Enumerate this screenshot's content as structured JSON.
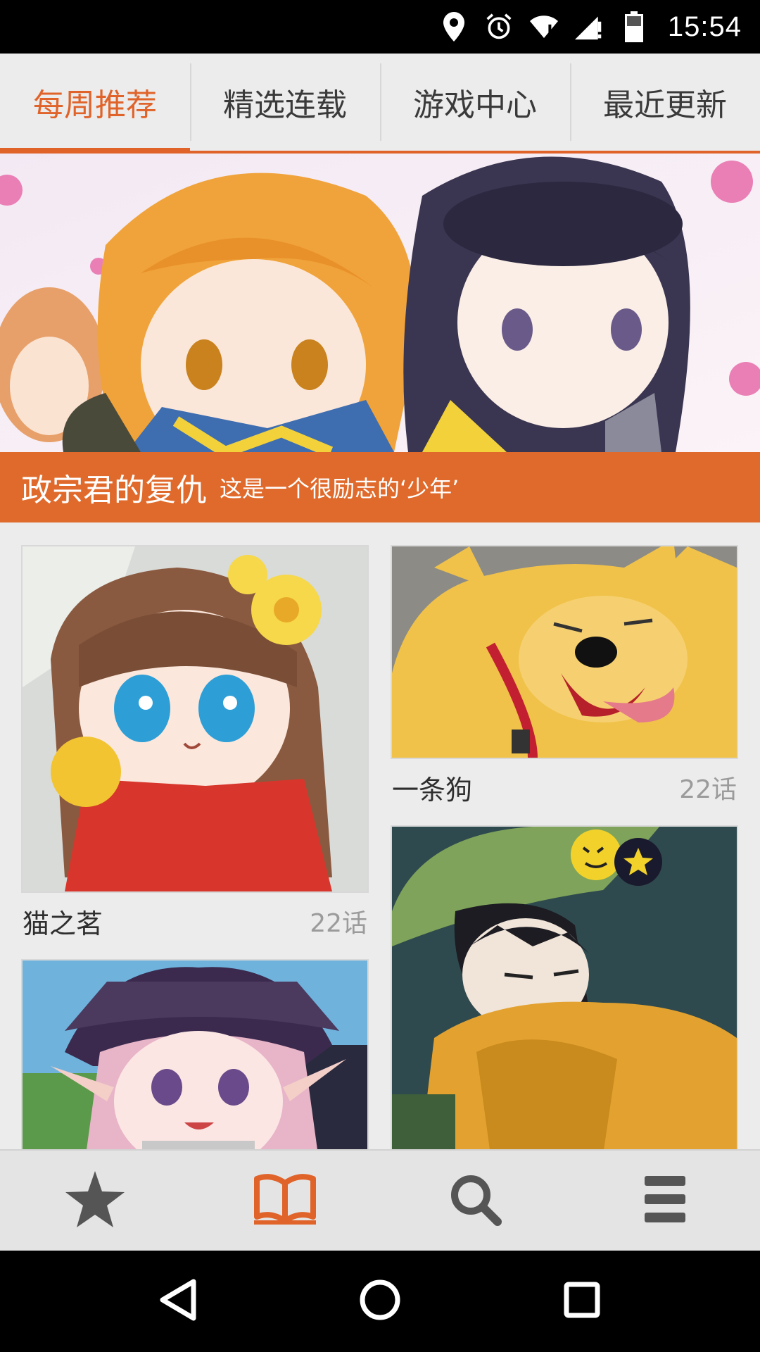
{
  "status_bar": {
    "time": "15:54",
    "icons": [
      "location-icon",
      "alarm-icon",
      "wifi-icon",
      "signal-icon",
      "battery-icon"
    ]
  },
  "tabs": [
    {
      "label": "每周推荐",
      "active": true
    },
    {
      "label": "精选连载",
      "active": false
    },
    {
      "label": "游戏中心",
      "active": false
    },
    {
      "label": "最近更新",
      "active": false
    }
  ],
  "banner": {
    "title": "政宗君的复仇",
    "subtitle": "这是一个很励志的‘少年’"
  },
  "comics": [
    {
      "title": "猫之茗",
      "chapters": "22话"
    },
    {
      "title": "一条狗",
      "chapters": "22话"
    },
    {
      "title": "",
      "chapters": ""
    },
    {
      "title": "",
      "chapters": ""
    }
  ],
  "bottom_nav": [
    {
      "icon": "star-icon",
      "active": false
    },
    {
      "icon": "book-icon",
      "active": true
    },
    {
      "icon": "search-icon",
      "active": false
    },
    {
      "icon": "menu-icon",
      "active": false
    }
  ],
  "colors": {
    "accent": "#e0632a",
    "background": "#ececec",
    "nav_icon": "#555555"
  }
}
